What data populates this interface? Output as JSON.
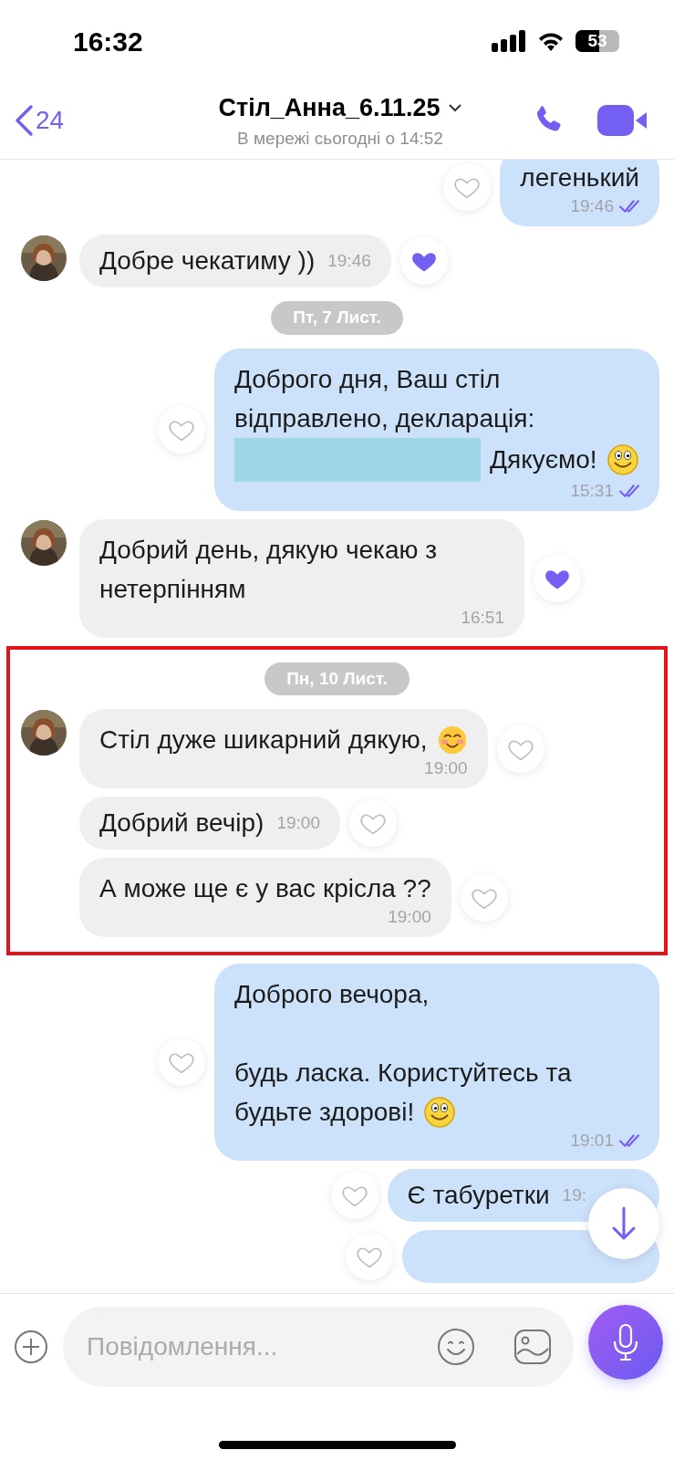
{
  "status_bar": {
    "time": "16:32",
    "battery": "53"
  },
  "header": {
    "back_count": "24",
    "title": "Стіл_Анна_6.11.25",
    "subtitle": "В мережі сьогодні о 14:52"
  },
  "messages": [
    {
      "kind": "message",
      "outgoing": true,
      "parts": [
        {
          "kind": "text",
          "text": "легенький"
        }
      ],
      "time": "19:46",
      "read": true,
      "liked": false,
      "time_inline": false,
      "highlighted": false
    },
    {
      "kind": "message",
      "outgoing": false,
      "avatar": true,
      "parts": [
        {
          "kind": "text",
          "text": "Добре чекатиму ))"
        }
      ],
      "time": "19:46",
      "liked": true,
      "time_inline": true,
      "highlighted": false
    },
    {
      "kind": "date",
      "text": "Пт, 7 Лист.",
      "highlighted": false
    },
    {
      "kind": "message",
      "outgoing": true,
      "parts": [
        {
          "kind": "text",
          "text": "Доброго дня, Ваш стіл\nвідправлено, декларація:"
        },
        {
          "kind": "redaction"
        },
        {
          "kind": "text",
          "text": "Дякуємо!"
        },
        {
          "kind": "smile"
        }
      ],
      "time": "15:31",
      "read": true,
      "liked": false,
      "time_inline": false,
      "highlighted": false
    },
    {
      "kind": "message",
      "outgoing": false,
      "avatar": true,
      "parts": [
        {
          "kind": "text",
          "text": "Добрий день, дякую чекаю з нетерпінням"
        }
      ],
      "time": "16:51",
      "liked": true,
      "time_inline": false,
      "highlighted": false
    },
    {
      "kind": "date",
      "text": "Пн, 10 Лист.",
      "highlighted": true
    },
    {
      "kind": "message",
      "outgoing": false,
      "avatar": true,
      "parts": [
        {
          "kind": "text",
          "text": "Стіл дуже шикарний дякую,"
        },
        {
          "kind": "blush"
        }
      ],
      "time": "19:00",
      "liked": false,
      "time_inline": false,
      "highlighted": true
    },
    {
      "kind": "message",
      "outgoing": false,
      "avatar": false,
      "parts": [
        {
          "kind": "text",
          "text": "Добрий вечір)"
        }
      ],
      "time": "19:00",
      "liked": false,
      "time_inline": true,
      "highlighted": true
    },
    {
      "kind": "message",
      "outgoing": false,
      "avatar": false,
      "parts": [
        {
          "kind": "text",
          "text": "А може ще є у вас крісла ??"
        }
      ],
      "time": "19:00",
      "liked": false,
      "time_inline": false,
      "highlighted": true
    },
    {
      "kind": "message",
      "outgoing": true,
      "parts": [
        {
          "kind": "text",
          "text": "Доброго вечора,\n\nбудь ласка. Користуйтесь та"
        },
        {
          "kind": "text",
          "text": "будьте здорові!"
        },
        {
          "kind": "smile"
        }
      ],
      "time": "19:01",
      "read": true,
      "liked": false,
      "time_inline": false,
      "highlighted": false
    },
    {
      "kind": "message",
      "outgoing": true,
      "parts": [
        {
          "kind": "text",
          "text": "Є табуретки"
        }
      ],
      "time": "19:",
      "covered": true,
      "liked": false,
      "time_inline": true,
      "highlighted": false
    },
    {
      "kind": "message",
      "outgoing": true,
      "liked": false,
      "time_inline": true,
      "highlighted": false
    }
  ],
  "composer": {
    "placeholder": "Повідомлення..."
  }
}
